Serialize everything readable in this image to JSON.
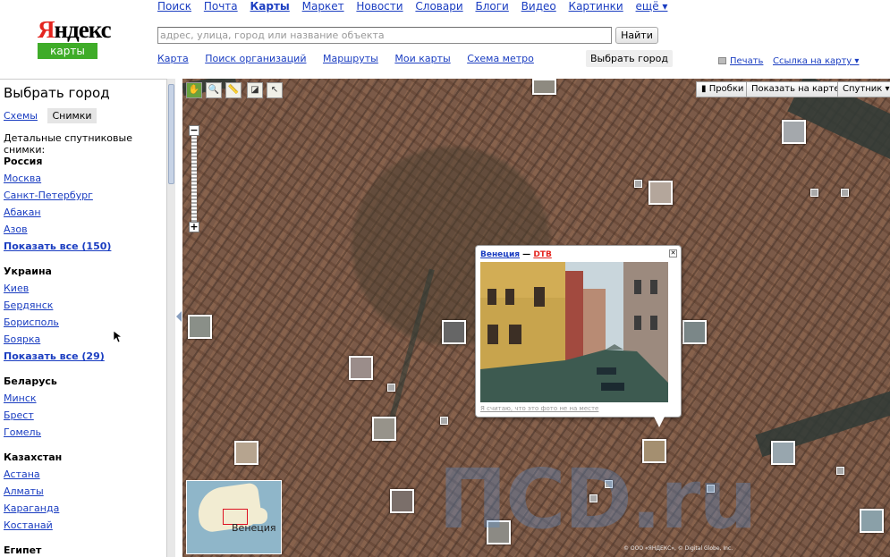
{
  "header": {
    "logo_text": "Яндекс",
    "logo_sub": "карты",
    "services": [
      "Поиск",
      "Почта",
      "Карты",
      "Маркет",
      "Новости",
      "Словари",
      "Блоги",
      "Видео",
      "Картинки",
      "ещё ▾"
    ],
    "search_placeholder": "адрес, улица, город или название объекта",
    "search_button": "Найти",
    "subnav": [
      "Карта",
      "Поиск организаций",
      "Маршруты",
      "Мои карты",
      "Схема метро"
    ],
    "choose_city": "Выбрать город",
    "print": "Печать",
    "map_link": "Ссылка на карту ▾"
  },
  "sidebar": {
    "title": "Выбрать город",
    "tab_schemes": "Схемы",
    "tab_photos": "Снимки",
    "description": "Детальные спутниковые снимки:",
    "groups": [
      {
        "country": "Россия",
        "cities": [
          "Москва",
          "Санкт-Петербург",
          "Абакан",
          "Азов"
        ],
        "show_all": "Показать все (150)"
      },
      {
        "country": "Украина",
        "cities": [
          "Киев",
          "Бердянск",
          "Борисполь",
          "Боярка"
        ],
        "show_all": "Показать все (29)"
      },
      {
        "country": "Беларусь",
        "cities": [
          "Минск",
          "Брест",
          "Гомель"
        ],
        "show_all": ""
      },
      {
        "country": "Казахстан",
        "cities": [
          "Астана",
          "Алматы",
          "Караганда",
          "Костанай"
        ],
        "show_all": ""
      },
      {
        "country": "Египет",
        "cities": [],
        "show_all": ""
      }
    ]
  },
  "map": {
    "traffic_button": "Пробки",
    "show_on_map": "Показать на карте",
    "satellite": "Спутник",
    "popup": {
      "location": "Венеция",
      "separator": " — ",
      "author": "DTB",
      "caption": "Я считаю, что это фото не на месте"
    },
    "minimap_label": "Венеция",
    "copyright": "© ООО «ЯНДЕКС», © Digital Globe, Inc."
  },
  "colors": {
    "accent_red": "#e4251f",
    "brand_green": "#3fac29",
    "link_blue": "#1a3dc1"
  }
}
